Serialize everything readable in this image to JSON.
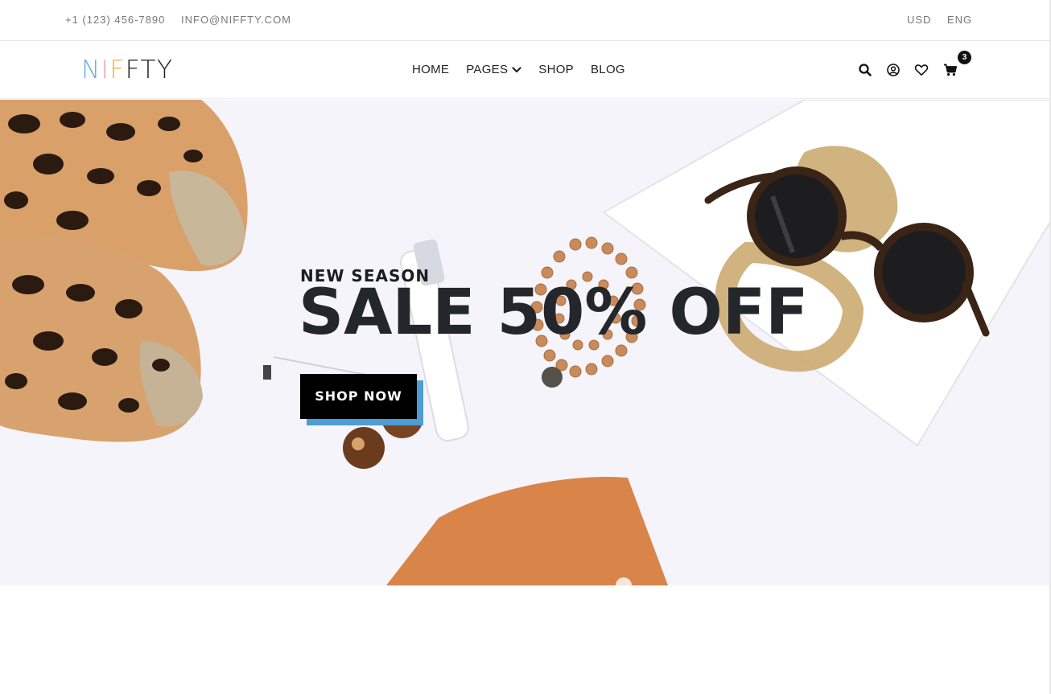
{
  "topbar": {
    "phone": "+1 (123) 456-7890",
    "email": "INFO@NIFFTY.COM",
    "currency": "USD",
    "language": "ENG"
  },
  "header": {
    "logo": {
      "letters": [
        "N",
        "I",
        "F",
        "F",
        "T",
        "Y"
      ],
      "colors": [
        "#6aaee0",
        "#f29bb0",
        "#f2b33d",
        "#222222",
        "#222222",
        "#222222"
      ]
    },
    "nav": [
      {
        "label": "HOME"
      },
      {
        "label": "PAGES",
        "has_dropdown": true
      },
      {
        "label": "SHOP"
      },
      {
        "label": "BLOG"
      }
    ],
    "icons": [
      "search-icon",
      "user-icon",
      "heart-icon",
      "cart-icon"
    ],
    "cart_count": "3"
  },
  "hero": {
    "eyebrow": "NEW SEASON",
    "title": "SALE 50% OFF",
    "button_label": "SHOP NOW",
    "accent_color": "#4d9cd3"
  }
}
